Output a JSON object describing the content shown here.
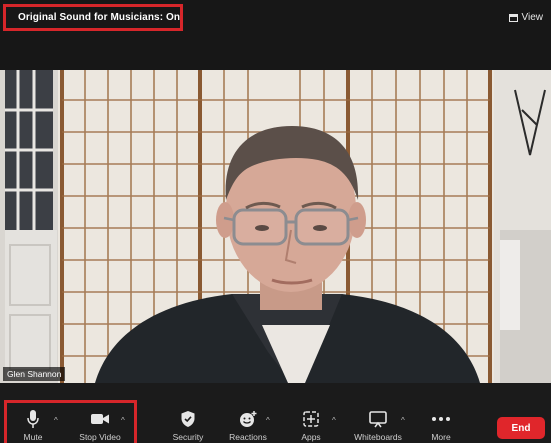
{
  "top": {
    "original_sound": "Original Sound for Musicians: On",
    "view_label": "View"
  },
  "video": {
    "participant_name": "Glen Shannon"
  },
  "toolbar": {
    "mute": "Mute",
    "stop_video": "Stop Video",
    "security": "Security",
    "reactions": "Reactions",
    "apps": "Apps",
    "whiteboards": "Whiteboards",
    "more": "More",
    "end": "End"
  },
  "colors": {
    "highlight": "#d6262a",
    "end_button": "#e0262b",
    "shield": "#2dbb4a"
  }
}
